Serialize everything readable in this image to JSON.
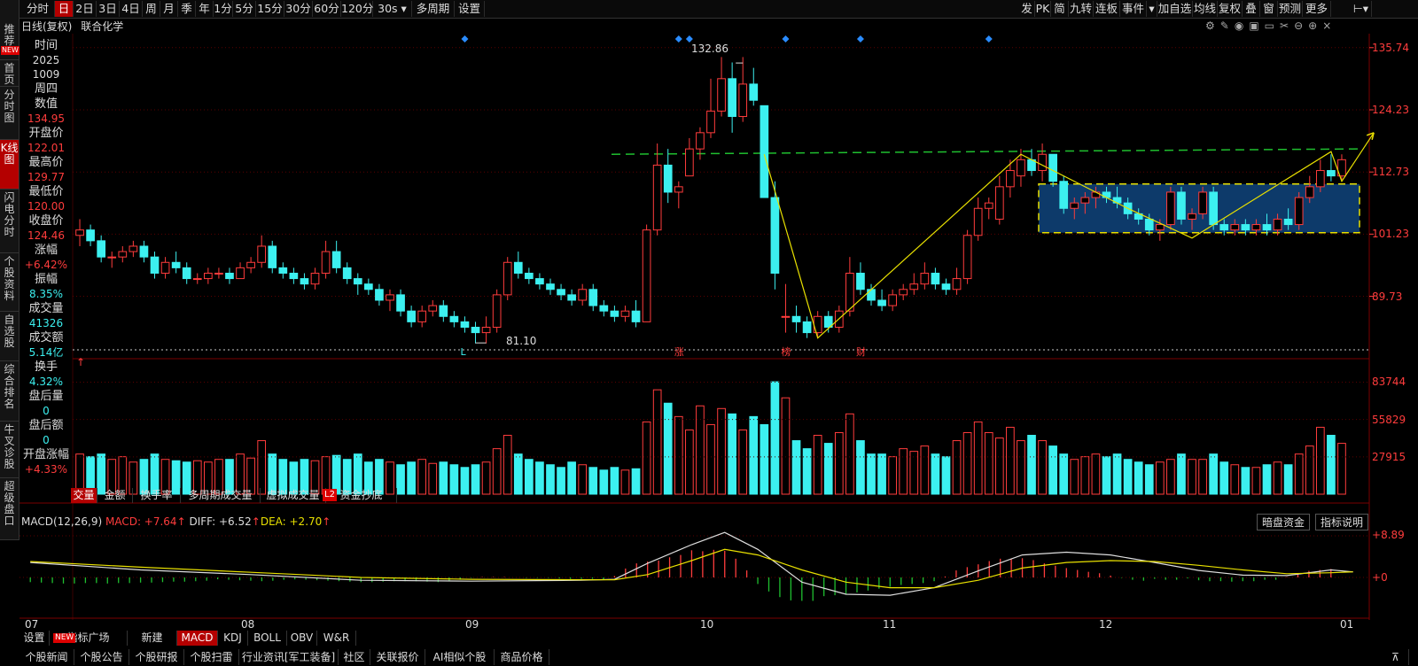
{
  "toolbar": {
    "left": [
      "分时",
      "日",
      "2日",
      "3日",
      "4日",
      "周",
      "月",
      "季",
      "年",
      "1分",
      "5分",
      "15分",
      "30分",
      "60分",
      "120分",
      "30s ▾",
      "多周期",
      "设置"
    ],
    "active_index": 1,
    "right": [
      "发",
      "PK",
      "简",
      "九转",
      "连板",
      "事件",
      "▾",
      "加自选",
      "均线",
      "复权",
      "叠",
      "窗",
      "预测",
      "更多"
    ]
  },
  "leftnav": [
    "推荐",
    "首页",
    "分时图",
    "K线图",
    "闪电分时",
    "个股资料",
    "自选股",
    "综合排名",
    "牛叉诊股",
    "超级盘口"
  ],
  "leftnav_new_badge": "NEW",
  "chart_header": {
    "period": "日线(复权)",
    "name": "联合化学"
  },
  "info_panel": [
    {
      "label": "时间",
      "value": "2025",
      "value2": "1009",
      "color": "white"
    },
    {
      "label": "周四",
      "value": "",
      "color": "white"
    },
    {
      "label": "数值",
      "value": "134.95",
      "color": "red"
    },
    {
      "label": "开盘价",
      "value": "122.01",
      "color": "red"
    },
    {
      "label": "最高价",
      "value": "129.77",
      "color": "red"
    },
    {
      "label": "最低价",
      "value": "120.00",
      "color": "red"
    },
    {
      "label": "收盘价",
      "value": "124.46",
      "color": "red"
    },
    {
      "label": "涨幅",
      "value": "+6.42%",
      "color": "red"
    },
    {
      "label": "振幅",
      "value": "8.35%",
      "color": "cyan"
    },
    {
      "label": "成交量",
      "value": "41326",
      "color": "cyan"
    },
    {
      "label": "成交额",
      "value": "5.14亿",
      "color": "cyan"
    },
    {
      "label": "换手",
      "value": "4.32%",
      "color": "cyan"
    },
    {
      "label": "盘后量",
      "value": "0",
      "color": "cyan"
    },
    {
      "label": "盘后额",
      "value": "0",
      "color": "cyan"
    },
    {
      "label": "开盘涨幅",
      "value": "+4.33%",
      "color": "red"
    }
  ],
  "price_axis": [
    "135.74",
    "124.23",
    "112.73",
    "101.23",
    "89.73"
  ],
  "price_annotations": {
    "high": "132.86",
    "low": "81.10"
  },
  "event_markers": [
    "L",
    "涨",
    "榜",
    "财"
  ],
  "volume_axis": [
    "83744",
    "55829",
    "27915"
  ],
  "indicator_tabs": [
    "交量",
    "金额",
    "换手率",
    "多周期成交量",
    "虚拟成交量",
    "资金抄底"
  ],
  "l2_badge": "L2",
  "macd": {
    "title": "MACD(12,26,9)",
    "macd_label": "MACD: +7.64",
    "diff_label": "DIFF: +6.52",
    "dea_label": "DEA: +2.70",
    "axis_top": "8.89",
    "axis_zero": "0",
    "btn_dark_pool": "暗盘资金",
    "btn_explain": "指标说明"
  },
  "x_axis_months": [
    "07",
    "08",
    "09",
    "10",
    "11",
    "12",
    "01"
  ],
  "bottom_tabs": [
    "设置",
    "指标广场",
    "新建",
    "MACD",
    "KDJ",
    "BOLL",
    "OBV",
    "W&R"
  ],
  "bottom_new_badge": "NEW",
  "news_tabs": [
    "个股新闻",
    "个股公告",
    "个股研报",
    "个股扫雷",
    "行业资讯[军工装备]",
    "社区",
    "关联报价",
    "AI相似个股",
    "商品价格"
  ],
  "chart_data": {
    "type": "candlestick",
    "price_range": [
      79,
      138
    ],
    "volume_max": 90000,
    "candles": [
      [
        101,
        104,
        99,
        102
      ],
      [
        102,
        103,
        99,
        100
      ],
      [
        100,
        101,
        96,
        97
      ],
      [
        97,
        98,
        95,
        97
      ],
      [
        97,
        99,
        96,
        98
      ],
      [
        98,
        100,
        97,
        99
      ],
      [
        99,
        100,
        96,
        97
      ],
      [
        97,
        98,
        93,
        94
      ],
      [
        94,
        97,
        93,
        96
      ],
      [
        96,
        98,
        94,
        95
      ],
      [
        95,
        96,
        92,
        93
      ],
      [
        93,
        94,
        92,
        93
      ],
      [
        93,
        95,
        92,
        94
      ],
      [
        94,
        95,
        93,
        94
      ],
      [
        94,
        95,
        92,
        93
      ],
      [
        93,
        96,
        93,
        95
      ],
      [
        95,
        97,
        94,
        96
      ],
      [
        96,
        101,
        95,
        99
      ],
      [
        99,
        100,
        94,
        95
      ],
      [
        95,
        96,
        93,
        94
      ],
      [
        94,
        95,
        92,
        93
      ],
      [
        93,
        94,
        91,
        92
      ],
      [
        92,
        95,
        91,
        94
      ],
      [
        94,
        100,
        93,
        98
      ],
      [
        98,
        100,
        94,
        95
      ],
      [
        95,
        96,
        92,
        93
      ],
      [
        93,
        94,
        90,
        92
      ],
      [
        92,
        93,
        90,
        91
      ],
      [
        91,
        92,
        88,
        89
      ],
      [
        89,
        91,
        87,
        90
      ],
      [
        90,
        91,
        86,
        87
      ],
      [
        87,
        88,
        84,
        85
      ],
      [
        85,
        88,
        84,
        87
      ],
      [
        87,
        89,
        86,
        88
      ],
      [
        88,
        89,
        85,
        86
      ],
      [
        86,
        87,
        84,
        85
      ],
      [
        85,
        86,
        83,
        84
      ],
      [
        84,
        85,
        81,
        83
      ],
      [
        83,
        86,
        81,
        84
      ],
      [
        84,
        91,
        83,
        90
      ],
      [
        90,
        97,
        89,
        96
      ],
      [
        96,
        98,
        93,
        94
      ],
      [
        94,
        95,
        92,
        93
      ],
      [
        93,
        94,
        91,
        92
      ],
      [
        92,
        93,
        90,
        91
      ],
      [
        91,
        92,
        89,
        90
      ],
      [
        90,
        91,
        88,
        89
      ],
      [
        89,
        92,
        88,
        91
      ],
      [
        91,
        92,
        87,
        88
      ],
      [
        88,
        89,
        86,
        87
      ],
      [
        87,
        88,
        85,
        86
      ],
      [
        86,
        88,
        85,
        87
      ],
      [
        87,
        89,
        84,
        85
      ],
      [
        85,
        103,
        85,
        102
      ],
      [
        102,
        118,
        101,
        114
      ],
      [
        114,
        117,
        107,
        109
      ],
      [
        109,
        111,
        106,
        110
      ],
      [
        112,
        119,
        112,
        117
      ],
      [
        117,
        121,
        115,
        120
      ],
      [
        120,
        130,
        119,
        124
      ],
      [
        124,
        134,
        123,
        130
      ],
      [
        130,
        133,
        120,
        123
      ],
      [
        123,
        134,
        122,
        129
      ],
      [
        129,
        132,
        125,
        126
      ],
      [
        125,
        125,
        108,
        108
      ],
      [
        108,
        111,
        91,
        94
      ],
      [
        86,
        92,
        83,
        86
      ],
      [
        86,
        88,
        83,
        85
      ],
      [
        85,
        86,
        82,
        83
      ],
      [
        83,
        87,
        82,
        86
      ],
      [
        86,
        87,
        83,
        84
      ],
      [
        84,
        88,
        83,
        87
      ],
      [
        87,
        97,
        86,
        94
      ],
      [
        94,
        96,
        90,
        91
      ],
      [
        91,
        92,
        88,
        89
      ],
      [
        89,
        91,
        87,
        88
      ],
      [
        88,
        91,
        87,
        90
      ],
      [
        90,
        92,
        89,
        91
      ],
      [
        91,
        94,
        90,
        92
      ],
      [
        92,
        96,
        91,
        94
      ],
      [
        94,
        95,
        91,
        92
      ],
      [
        92,
        93,
        90,
        91
      ],
      [
        91,
        95,
        90,
        93
      ],
      [
        93,
        102,
        92,
        101
      ],
      [
        101,
        108,
        100,
        106
      ],
      [
        106,
        108,
        104,
        107
      ],
      [
        104,
        112,
        103,
        110
      ],
      [
        110,
        115,
        108,
        113
      ],
      [
        112,
        117,
        110,
        115
      ],
      [
        115,
        117,
        112,
        113
      ],
      [
        113,
        118,
        111,
        116
      ],
      [
        116,
        116,
        110,
        111
      ],
      [
        111,
        112,
        105,
        106
      ],
      [
        106,
        108,
        104,
        107
      ],
      [
        107,
        109,
        105,
        108
      ],
      [
        108,
        110,
        106,
        109
      ],
      [
        109,
        110,
        107,
        108
      ],
      [
        108,
        110,
        106,
        107
      ],
      [
        107,
        108,
        104,
        105
      ],
      [
        105,
        106,
        103,
        104
      ],
      [
        104,
        105,
        101,
        102
      ],
      [
        102,
        104,
        100,
        103
      ],
      [
        103,
        110,
        102,
        109
      ],
      [
        109,
        110,
        103,
        104
      ],
      [
        104,
        106,
        102,
        105
      ],
      [
        105,
        110,
        104,
        109
      ],
      [
        109,
        110,
        102,
        103
      ],
      [
        103,
        104,
        101,
        102
      ],
      [
        102,
        104,
        101,
        103
      ],
      [
        103,
        104,
        101,
        102
      ],
      [
        102,
        104,
        101,
        103
      ],
      [
        103,
        105,
        101,
        102
      ],
      [
        102,
        105,
        101,
        104
      ],
      [
        104,
        106,
        102,
        103
      ],
      [
        103,
        109,
        102,
        108
      ],
      [
        108,
        112,
        107,
        110
      ],
      [
        110,
        115,
        109,
        113
      ],
      [
        113,
        116,
        111,
        112
      ],
      [
        112,
        116,
        111,
        115
      ]
    ],
    "volumes": [
      30000,
      28000,
      30000,
      26000,
      28000,
      24000,
      26000,
      30000,
      26000,
      25000,
      24000,
      25000,
      24000,
      26000,
      26000,
      30000,
      27000,
      40000,
      30000,
      26000,
      24000,
      26000,
      25000,
      28000,
      29000,
      26000,
      30000,
      24000,
      26000,
      24000,
      22000,
      24000,
      26000,
      23000,
      24000,
      22000,
      20000,
      22000,
      24000,
      34000,
      44000,
      30000,
      26000,
      24000,
      22000,
      20000,
      24000,
      22000,
      20000,
      18000,
      20000,
      18000,
      19000,
      54000,
      78000,
      68000,
      58000,
      48000,
      66000,
      52000,
      64000,
      60000,
      48000,
      58000,
      52000,
      84000,
      72000,
      40000,
      34000,
      44000,
      38000,
      46000,
      60000,
      40000,
      30000,
      30000,
      28000,
      34000,
      32000,
      36000,
      30000,
      28000,
      40000,
      46000,
      54000,
      46000,
      42000,
      50000,
      40000,
      44000,
      40000,
      36000,
      30000,
      26000,
      28000,
      30000,
      28000,
      30000,
      26000,
      24000,
      22000,
      24000,
      26000,
      30000,
      26000,
      26000,
      30000,
      24000,
      22000,
      20000,
      20000,
      22000,
      24000,
      22000,
      30000,
      36000,
      50000,
      44000,
      38000
    ],
    "macd_hist": [
      -1.0,
      -1.1,
      -1.2,
      -1.3,
      -1.3,
      -1.2,
      -1.2,
      -1.3,
      -1.2,
      -1.2,
      -1.1,
      -1.1,
      -1.0,
      -0.9,
      -0.9,
      -0.8,
      -0.7,
      -0.4,
      -0.5,
      -0.6,
      -0.7,
      -0.8,
      -0.7,
      -0.5,
      -0.4,
      -0.5,
      -0.6,
      -0.7,
      -0.8,
      -0.9,
      -1.0,
      -1.0,
      -0.9,
      -0.8,
      -0.8,
      -0.8,
      -0.9,
      -1.0,
      -0.8,
      -0.5,
      -0.1,
      0.1,
      0.1,
      0.1,
      0.0,
      -0.1,
      -0.1,
      -0.1,
      -0.2,
      -0.3,
      -0.3,
      -0.3,
      -0.4,
      0.3,
      1.9,
      3.0,
      3.4,
      3.6,
      4.3,
      4.8,
      5.8,
      5.6,
      5.9,
      5.7,
      4.0,
      1.5,
      -1.4,
      -3.0,
      -4.2,
      -4.9,
      -5.0,
      -5.0,
      -4.0,
      -3.8,
      -3.5,
      -3.2,
      -2.8,
      -2.4,
      -2.0,
      -1.6,
      -1.4,
      -1.2,
      -0.8,
      0.2,
      1.5,
      2.2,
      2.8,
      3.5,
      4.0,
      4.0,
      4.1,
      3.7,
      3.0,
      2.5,
      2.0,
      1.6,
      1.2,
      0.9,
      0.4,
      -0.1,
      -0.5,
      -0.7,
      -0.3,
      -0.5,
      -0.5,
      -0.2,
      -0.6,
      -0.8,
      -0.8,
      -0.9,
      -0.8,
      -0.8,
      -0.5,
      -0.5,
      0.1,
      0.7,
      1.4,
      1.6,
      1.8
    ],
    "macd_ylim": [
      -6,
      9
    ]
  }
}
